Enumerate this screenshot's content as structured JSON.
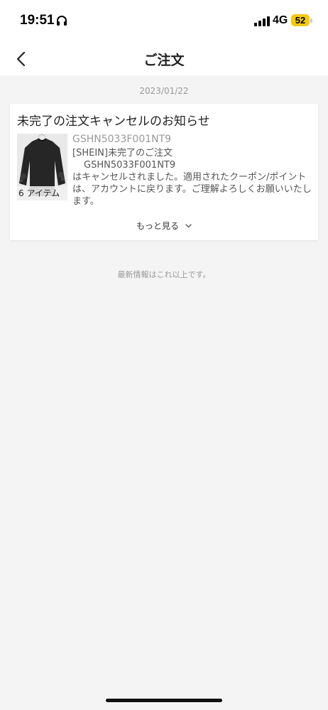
{
  "status_bar": {
    "time": "19:51",
    "network": "4G",
    "battery": "52",
    "icons": [
      "headphones-icon",
      "signal-icon",
      "battery-icon"
    ]
  },
  "nav": {
    "title": "ご注文",
    "back_icon": "chevron-left-icon"
  },
  "date": "2023/01/22",
  "message": {
    "title": "未完了の注文キャンセルのお知らせ",
    "item_count": "6 アイテム",
    "order_id": "GSHN5033F001NT9",
    "body_line1": "[SHEIN]未完了のご注文",
    "body_line2": "GSHN5033F001NT9",
    "body_line3": "はキャンセルされました。適用されたクーポン/ポイントは、アカウントに戻ります。ご理解よろしくお願いいたします。",
    "see_more": "もっと見る",
    "see_more_icon": "chevron-down-icon"
  },
  "end_note": "最新情報はこれ以上です。",
  "colors": {
    "background": "#f4f4f4",
    "card": "#ffffff",
    "battery": "#f6c913",
    "muted_text": "#999999"
  }
}
